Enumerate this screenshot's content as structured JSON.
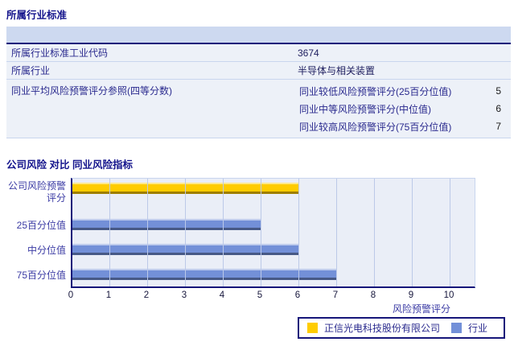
{
  "industry_section": {
    "title": "所属行业标准",
    "rows": [
      {
        "label": "所属行业标准工业代码",
        "value": "3674"
      },
      {
        "label": "所属行业",
        "value": "半导体与相关装置"
      },
      {
        "label": "同业平均风险预警评分参照(四等分数)",
        "sub_rows": [
          {
            "label": "同业较低风险预警评分(25百分位值)",
            "value": "5"
          },
          {
            "label": "同业中等风险预警评分(中位值)",
            "value": "6"
          },
          {
            "label": "同业较高风险预警评分(75百分位值)",
            "value": "7"
          }
        ]
      }
    ]
  },
  "comparison_section": {
    "title": "公司风险 对比 同业风险指标"
  },
  "chart_data": {
    "type": "bar",
    "orientation": "horizontal",
    "title": "公司风险 对比 同业风险指标",
    "categories": [
      "公司风险预警评分",
      "25百分位值",
      "中分位值",
      "75百分位值"
    ],
    "series": [
      {
        "name": "正信光电科技股份有限公司",
        "color": "#FFCC00",
        "values": [
          6,
          null,
          null,
          null
        ]
      },
      {
        "name": "行业",
        "color": "#7390D8",
        "values": [
          null,
          5,
          6,
          7
        ]
      }
    ],
    "xlabel": "风险预警评分",
    "ylabel": "",
    "xlim": [
      0,
      10
    ],
    "xticks": [
      0,
      1,
      2,
      3,
      4,
      5,
      6,
      7,
      8,
      9,
      10
    ],
    "grid": "vertical",
    "legend_position": "bottom-right",
    "plot_background": "#EAEEF7",
    "gridline_color": "#BCC9E8",
    "axis_color": "#16167A"
  },
  "colors": {
    "title_text": "#14148C",
    "table_header_bg": "#CDD9F0",
    "table_row_bg": "#EDF1F8",
    "row_divider": "#C9D5EE",
    "header_rule": "#16167A",
    "label_text": "#2A2A8E",
    "value_text": "#202060"
  }
}
